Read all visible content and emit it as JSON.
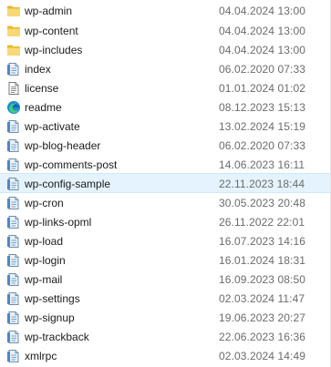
{
  "files": [
    {
      "name": "wp-admin",
      "date": "04.04.2024 13:00",
      "icon": "folder-icon"
    },
    {
      "name": "wp-content",
      "date": "04.04.2024 13:00",
      "icon": "folder-icon"
    },
    {
      "name": "wp-includes",
      "date": "04.04.2024 13:00",
      "icon": "folder-icon"
    },
    {
      "name": "index",
      "date": "06.02.2020 07:33",
      "icon": "script-file-icon"
    },
    {
      "name": "license",
      "date": "01.01.2024 01:02",
      "icon": "text-file-icon"
    },
    {
      "name": "readme",
      "date": "08.12.2023 15:13",
      "icon": "edge-browser-icon"
    },
    {
      "name": "wp-activate",
      "date": "13.02.2024 15:19",
      "icon": "script-file-icon"
    },
    {
      "name": "wp-blog-header",
      "date": "06.02.2020 07:33",
      "icon": "script-file-icon"
    },
    {
      "name": "wp-comments-post",
      "date": "14.06.2023 16:11",
      "icon": "script-file-icon"
    },
    {
      "name": "wp-config-sample",
      "date": "22.11.2023 18:44",
      "icon": "script-file-icon",
      "selected": true
    },
    {
      "name": "wp-cron",
      "date": "30.05.2023 20:48",
      "icon": "script-file-icon"
    },
    {
      "name": "wp-links-opml",
      "date": "26.11.2022 22:01",
      "icon": "script-file-icon"
    },
    {
      "name": "wp-load",
      "date": "16.07.2023 14:16",
      "icon": "script-file-icon"
    },
    {
      "name": "wp-login",
      "date": "16.01.2024 18:31",
      "icon": "script-file-icon"
    },
    {
      "name": "wp-mail",
      "date": "16.09.2023 08:50",
      "icon": "script-file-icon"
    },
    {
      "name": "wp-settings",
      "date": "02.03.2024 11:47",
      "icon": "script-file-icon"
    },
    {
      "name": "wp-signup",
      "date": "19.06.2023 20:27",
      "icon": "script-file-icon"
    },
    {
      "name": "wp-trackback",
      "date": "22.06.2023 16:36",
      "icon": "script-file-icon"
    },
    {
      "name": "xmlrpc",
      "date": "02.03.2024 14:49",
      "icon": "script-file-icon"
    }
  ],
  "colors": {
    "selection_bg": "#e5f3ff",
    "folder_yellow": "#f8d775",
    "date_gray": "#6b6b6b"
  }
}
